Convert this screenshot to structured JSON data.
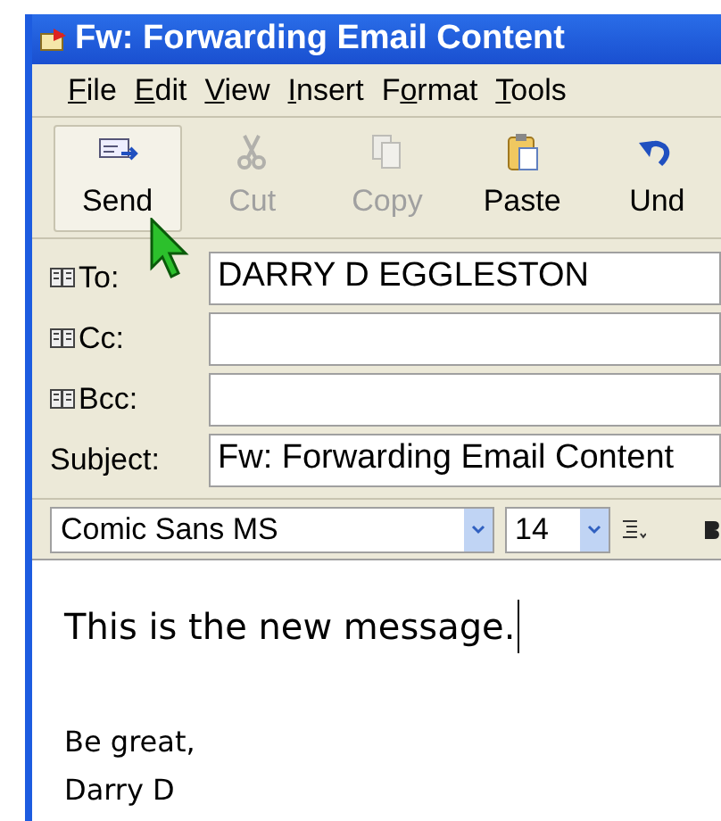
{
  "window": {
    "title": "Fw: Forwarding Email Content"
  },
  "menu": [
    {
      "accel": "F",
      "post": "ile"
    },
    {
      "accel": "E",
      "post": "dit"
    },
    {
      "accel": "V",
      "post": "iew"
    },
    {
      "accel": "I",
      "post": "nsert"
    },
    {
      "pre": "F",
      "accel": "o",
      "post": "rmat"
    },
    {
      "accel": "T",
      "post": "ools"
    }
  ],
  "toolbar": [
    {
      "kind": "send",
      "label": "Send",
      "disabled": false,
      "hovered": true
    },
    {
      "kind": "cut",
      "label": "Cut",
      "disabled": true,
      "hovered": false
    },
    {
      "kind": "copy",
      "label": "Copy",
      "disabled": true,
      "hovered": false
    },
    {
      "kind": "paste",
      "label": "Paste",
      "disabled": false,
      "hovered": false
    },
    {
      "kind": "undo",
      "label": "Und",
      "disabled": false,
      "hovered": false
    }
  ],
  "fields": [
    {
      "kind": "address",
      "label": "To:",
      "value": "DARRY D EGGLESTON"
    },
    {
      "kind": "address",
      "label": "Cc:"
    },
    {
      "kind": "address",
      "label": "Bcc:"
    },
    {
      "kind": "plain",
      "label": "Subject:",
      "value": "Fw: Forwarding Email Content"
    }
  ],
  "format_bar": {
    "font": "Comic Sans MS",
    "size": "14"
  },
  "body": [
    {
      "text": "This is the new message.",
      "caret": true,
      "kind": "large"
    },
    {
      "text": "Be great,",
      "caret": false,
      "kind": "normal"
    },
    {
      "text": "Darry D",
      "caret": false,
      "kind": "normal"
    }
  ]
}
